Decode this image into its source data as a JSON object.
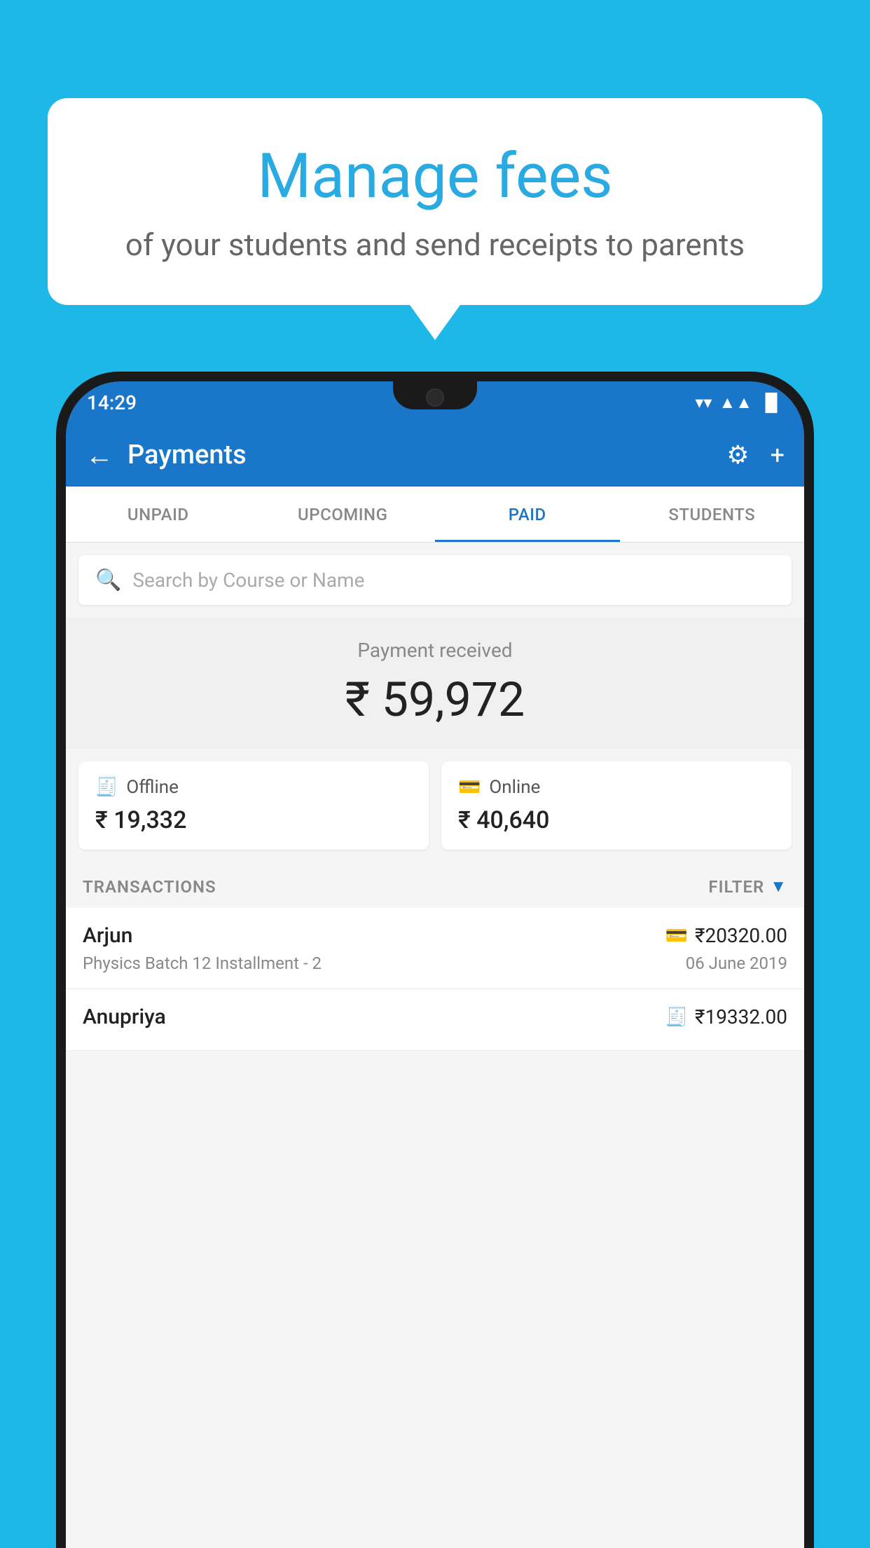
{
  "background_color": "#1db8e8",
  "speech_bubble": {
    "title": "Manage fees",
    "subtitle": "of your students and send receipts to parents"
  },
  "status_bar": {
    "time": "14:29",
    "wifi": "▼",
    "signal": "▲",
    "battery": "▐"
  },
  "header": {
    "title": "Payments",
    "back_label": "←",
    "gear_label": "⚙",
    "plus_label": "+"
  },
  "tabs": [
    {
      "id": "unpaid",
      "label": "UNPAID",
      "active": false
    },
    {
      "id": "upcoming",
      "label": "UPCOMING",
      "active": false
    },
    {
      "id": "paid",
      "label": "PAID",
      "active": true
    },
    {
      "id": "students",
      "label": "STUDENTS",
      "active": false
    }
  ],
  "search": {
    "placeholder": "Search by Course or Name"
  },
  "payment_summary": {
    "label": "Payment received",
    "amount": "₹ 59,972",
    "offline_label": "Offline",
    "offline_amount": "₹ 19,332",
    "online_label": "Online",
    "online_amount": "₹ 40,640"
  },
  "transactions": {
    "label": "TRANSACTIONS",
    "filter_label": "FILTER",
    "items": [
      {
        "name": "Arjun",
        "amount": "₹20320.00",
        "description": "Physics Batch 12 Installment - 2",
        "date": "06 June 2019",
        "payment_type": "online"
      },
      {
        "name": "Anupriya",
        "amount": "₹19332.00",
        "description": "",
        "date": "",
        "payment_type": "offline"
      }
    ]
  },
  "colors": {
    "primary": "#1976c9",
    "accent": "#1db8e8",
    "text_dark": "#222",
    "text_muted": "#888"
  }
}
